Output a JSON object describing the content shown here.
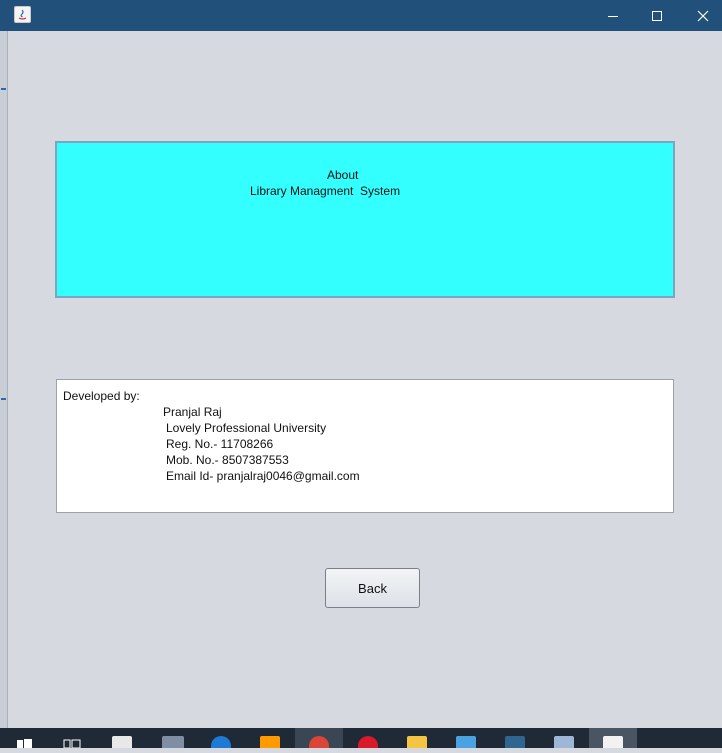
{
  "window": {
    "controls": [
      "minimize",
      "maximize",
      "close"
    ]
  },
  "about_panel": {
    "line1": "About",
    "line2": "Library Managment  System",
    "background": "#33ffff"
  },
  "developer_panel": {
    "label": "Developed by:",
    "name": "Pranjal Raj",
    "lines": [
      "Lovely Professional University",
      "Reg. No.- 11708266",
      "Mob. No.- 8507387553",
      "Email Id- pranjalraj0046@gmail.com"
    ]
  },
  "back_button": {
    "label": "Back"
  },
  "taskbar": {
    "icons": [
      "windows-start-icon",
      "task-view-icon",
      "store-icon",
      "dev-cpp-icon",
      "edge-icon",
      "sublime-icon",
      "chrome-icon",
      "opera-icon",
      "file-explorer-icon",
      "photos-icon",
      "mysql-workbench-icon",
      "virtualbox-icon",
      "java-icon"
    ]
  }
}
